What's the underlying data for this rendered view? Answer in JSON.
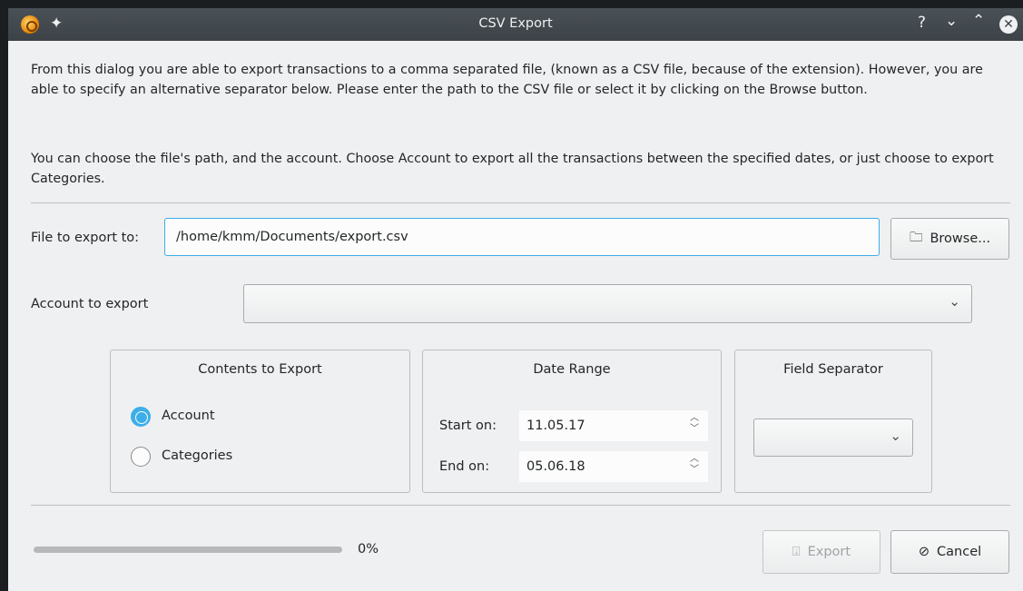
{
  "window": {
    "title": "CSV Export",
    "controls": {
      "help": "?",
      "minimize": "⌄",
      "maximize": "⌃",
      "close": "✕"
    }
  },
  "description": {
    "para1": "From this dialog you are able to export transactions to a comma separated file, (known as a CSV file, because of the extension). However, you are able to specify an alternative separator below.  Please enter the path to the CSV file or select it by clicking on the Browse button.",
    "para2": "You can choose the file's path, and the account. Choose Account to export all the transactions between the specified dates,  or just choose to export Categories."
  },
  "file": {
    "label": "File to export to:",
    "value": "/home/kmm/Documents/export.csv",
    "browse_label": "Browse..."
  },
  "account": {
    "label": "Account to export",
    "selected": ""
  },
  "contents": {
    "title": "Contents to Export",
    "options": [
      {
        "label": "Account",
        "checked": true
      },
      {
        "label": "Categories",
        "checked": false
      }
    ]
  },
  "date_range": {
    "title": "Date Range",
    "start_label": "Start on:",
    "start_value": "11.05.17",
    "end_label": "End on:",
    "end_value": "05.06.18"
  },
  "field_separator": {
    "title": "Field Separator",
    "selected": ""
  },
  "progress": {
    "value": 0,
    "label": "0%"
  },
  "buttons": {
    "export_label": "Export",
    "cancel_label": "Cancel"
  },
  "colors": {
    "accent": "#3daee9",
    "titlebar": "#3c4247",
    "window_bg": "#eff0f1"
  }
}
